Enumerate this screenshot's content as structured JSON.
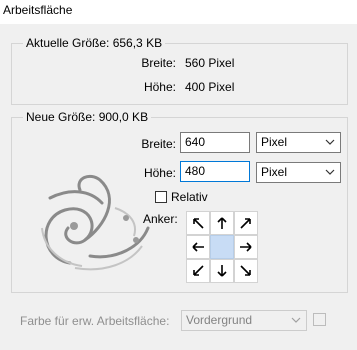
{
  "window": {
    "title": "Arbeitsfläche"
  },
  "current_size": {
    "legend": "Aktuelle Größe: 656,3 KB",
    "width_label": "Breite:",
    "width_value": "560 Pixel",
    "height_label": "Höhe:",
    "height_value": "400 Pixel"
  },
  "new_size": {
    "legend": "Neue Größe: 900,0 KB",
    "width_label": "Breite:",
    "width_value": "640",
    "width_unit": "Pixel",
    "height_label": "Höhe:",
    "height_value": "480",
    "height_unit": "Pixel",
    "relative_label": "Relativ",
    "relative_checked": false,
    "anchor_label": "Anker:",
    "anchor_selected": "center"
  },
  "extension_color": {
    "label": "Farbe für erw. Arbeitsfläche:",
    "value": "Vordergrund"
  },
  "colors": {
    "focus_border": "#0078d7",
    "anchor_selected": "#c8dcf5"
  }
}
